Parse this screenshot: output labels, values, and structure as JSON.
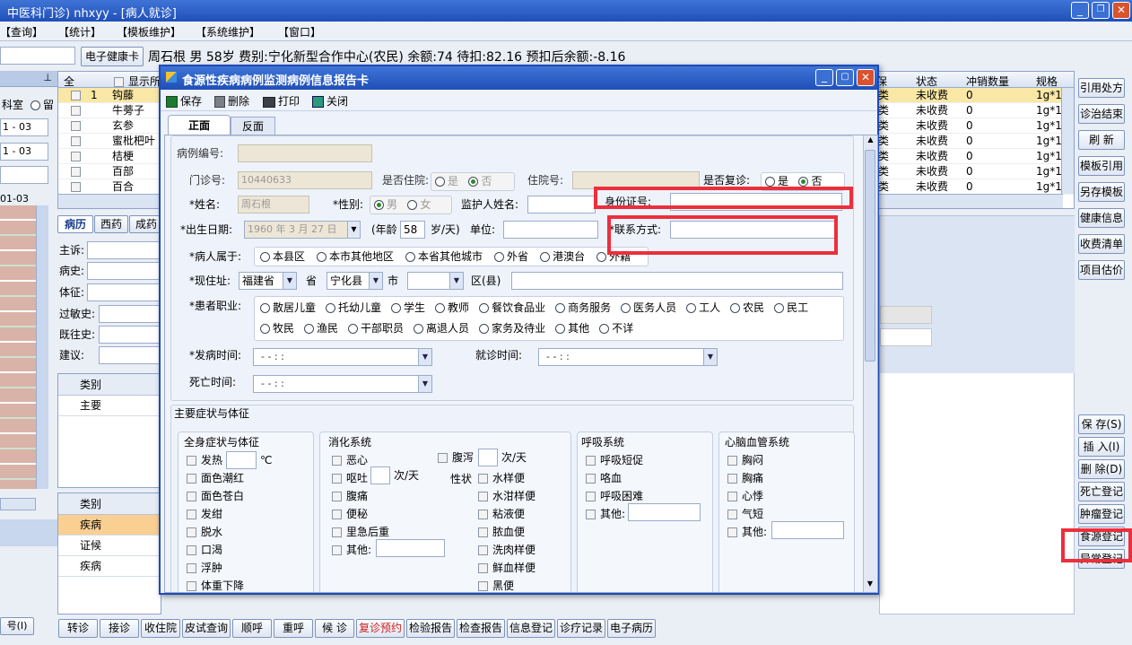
{
  "window": {
    "title": "中医科门诊) nhxyy - [病人就诊]"
  },
  "menu": [
    "【查询】",
    "【统计】",
    "【模板维护】",
    "【系统维护】",
    "【窗口】"
  ],
  "patient": {
    "card_button": "电子健康卡",
    "info": "周石根  男  58岁  费别:宁化新型合作中心(农民)  余额:74 待扣:82.16 预扣后余额:-8.16"
  },
  "left_panel": {
    "label_keshi": "科室",
    "label_liu": "留",
    "date1": "1 - 03",
    "date2": "1 - 03",
    "date3": "01-03",
    "tabs": [
      "病历",
      "西药",
      "成药"
    ],
    "fields": [
      "主诉:",
      "病史:",
      "体征:",
      "过敏史:",
      "既往史:",
      "建议:"
    ],
    "grid1": {
      "header": "类别",
      "rows": [
        "主要"
      ]
    },
    "grid2": {
      "header": "类别",
      "rows": [
        "疾病",
        "证候",
        "疾病"
      ]
    },
    "btn_bottom": "号(I)"
  },
  "med_table": {
    "headers": [
      "全",
      "",
      "显示所"
    ],
    "rows": [
      {
        "no": "1",
        "name": "钩藤"
      },
      {
        "no": "",
        "name": "牛蒡子"
      },
      {
        "no": "",
        "name": "玄参"
      },
      {
        "no": "",
        "name": "蜜枇杷叶"
      },
      {
        "no": "",
        "name": "桔梗"
      },
      {
        "no": "",
        "name": "百部"
      },
      {
        "no": "",
        "name": "百合"
      }
    ],
    "right_headers": [
      "保",
      "状态",
      "冲销数量",
      "规格"
    ],
    "right_rows": [
      {
        "a": "类",
        "status": "未收费",
        "qty": "0",
        "spec": "1g*1("
      },
      {
        "a": "类",
        "status": "未收费",
        "qty": "0",
        "spec": "1g*1("
      },
      {
        "a": "类",
        "status": "未收费",
        "qty": "0",
        "spec": "1g*1("
      },
      {
        "a": "类",
        "status": "未收费",
        "qty": "0",
        "spec": "1g*1("
      },
      {
        "a": "类",
        "status": "未收费",
        "qty": "0",
        "spec": "1g*1("
      },
      {
        "a": "类",
        "status": "未收费",
        "qty": "0",
        "spec": "1g*1("
      },
      {
        "a": "类",
        "status": "未收费",
        "qty": "0",
        "spec": "1g*1("
      }
    ]
  },
  "right_buttons": [
    "引用处方",
    "诊治结束",
    "刷 新",
    "模板引用",
    "另存模板",
    "健康信息",
    "收费清单",
    "项目估价"
  ],
  "right_buttons2": [
    "保 存(S)",
    "插 入(I)",
    "删 除(D)",
    "死亡登记",
    "肿瘤登记",
    "食源登记",
    "异常登记"
  ],
  "bottom_buttons": [
    "转诊",
    "接诊",
    "收住院",
    "皮试查询",
    "顺呼",
    "重呼",
    "候 诊",
    "复诊预约",
    "检验报告",
    "检查报告",
    "信息登记",
    "诊疗记录",
    "电子病历"
  ],
  "dialog": {
    "title": "食源性疾病病例监测病例信息报告卡",
    "toolbar": [
      "保存",
      "删除",
      "打印",
      "关闭"
    ],
    "tabs": [
      "正面",
      "反面"
    ],
    "labels": {
      "case_no": "病例编号:",
      "clinic_no": "门诊号:",
      "clinic_no_val": "10440633",
      "inhosp": "是否住院:",
      "yes": "是",
      "no": "否",
      "hosp_no": "住院号:",
      "revisit": "是否复诊:",
      "idcard": "身份证号:",
      "name": "*姓名:",
      "name_val": "周石根",
      "gender": "*性别:",
      "male": "男",
      "female": "女",
      "guardian": "监护人姓名:",
      "birth": "*出生日期:",
      "birth_val": "1960 年 3 月 27 日",
      "age_l": "(年龄",
      "age_val": "58",
      "age_unit": "岁/天)",
      "unit": "单位:",
      "contact": "*联系方式:",
      "belong": "*病人属于:",
      "addr": "*现住址:",
      "prov": "福建省",
      "sheng": "省",
      "county": "宁化县",
      "xian": "县",
      "shi": "市",
      "qu": "区(县)",
      "job": "*患者职业:",
      "onset": "*发病时间:",
      "visit": "就诊时间:",
      "death": "死亡时间:",
      "date_blank": "-   -      :   :",
      "symptoms": "主要症状与体征",
      "c": "℃",
      "per_day": "次/天",
      "xingzhuang": "性状"
    },
    "belong_opts": [
      "本县区",
      "本市其他地区",
      "本省其他城市",
      "外省",
      "港澳台",
      "外籍"
    ],
    "jobs1": [
      "散居儿童",
      "托幼儿童",
      "学生",
      "教师",
      "餐饮食品业",
      "商务服务",
      "医务人员",
      "工人",
      "农民",
      "民工"
    ],
    "jobs2": [
      "牧民",
      "渔民",
      "干部职员",
      "离退人员",
      "家务及待业",
      "其他",
      "不详"
    ],
    "groups": [
      {
        "title": "全身症状与体征",
        "items": [
          "发热",
          "面色潮红",
          "面色苍白",
          "发绀",
          "脱水",
          "口渴",
          "浮肿",
          "体重下降"
        ]
      },
      {
        "title": "消化系统",
        "items": [
          "恶心",
          "呕吐",
          "腹痛",
          "便秘",
          "里急后重",
          "其他:"
        ],
        "items2": [
          "腹泻",
          "水样便",
          "水泔样便",
          "粘液便",
          "脓血便",
          "洗肉样便",
          "鲜血样便",
          "黑便"
        ]
      },
      {
        "title": "呼吸系统",
        "items": [
          "呼吸短促",
          "咯血",
          "呼吸困难",
          "其他:"
        ]
      },
      {
        "title": "心脑血管系统",
        "items": [
          "胸闷",
          "胸痛",
          "心悸",
          "气短",
          "其他:"
        ]
      }
    ]
  }
}
